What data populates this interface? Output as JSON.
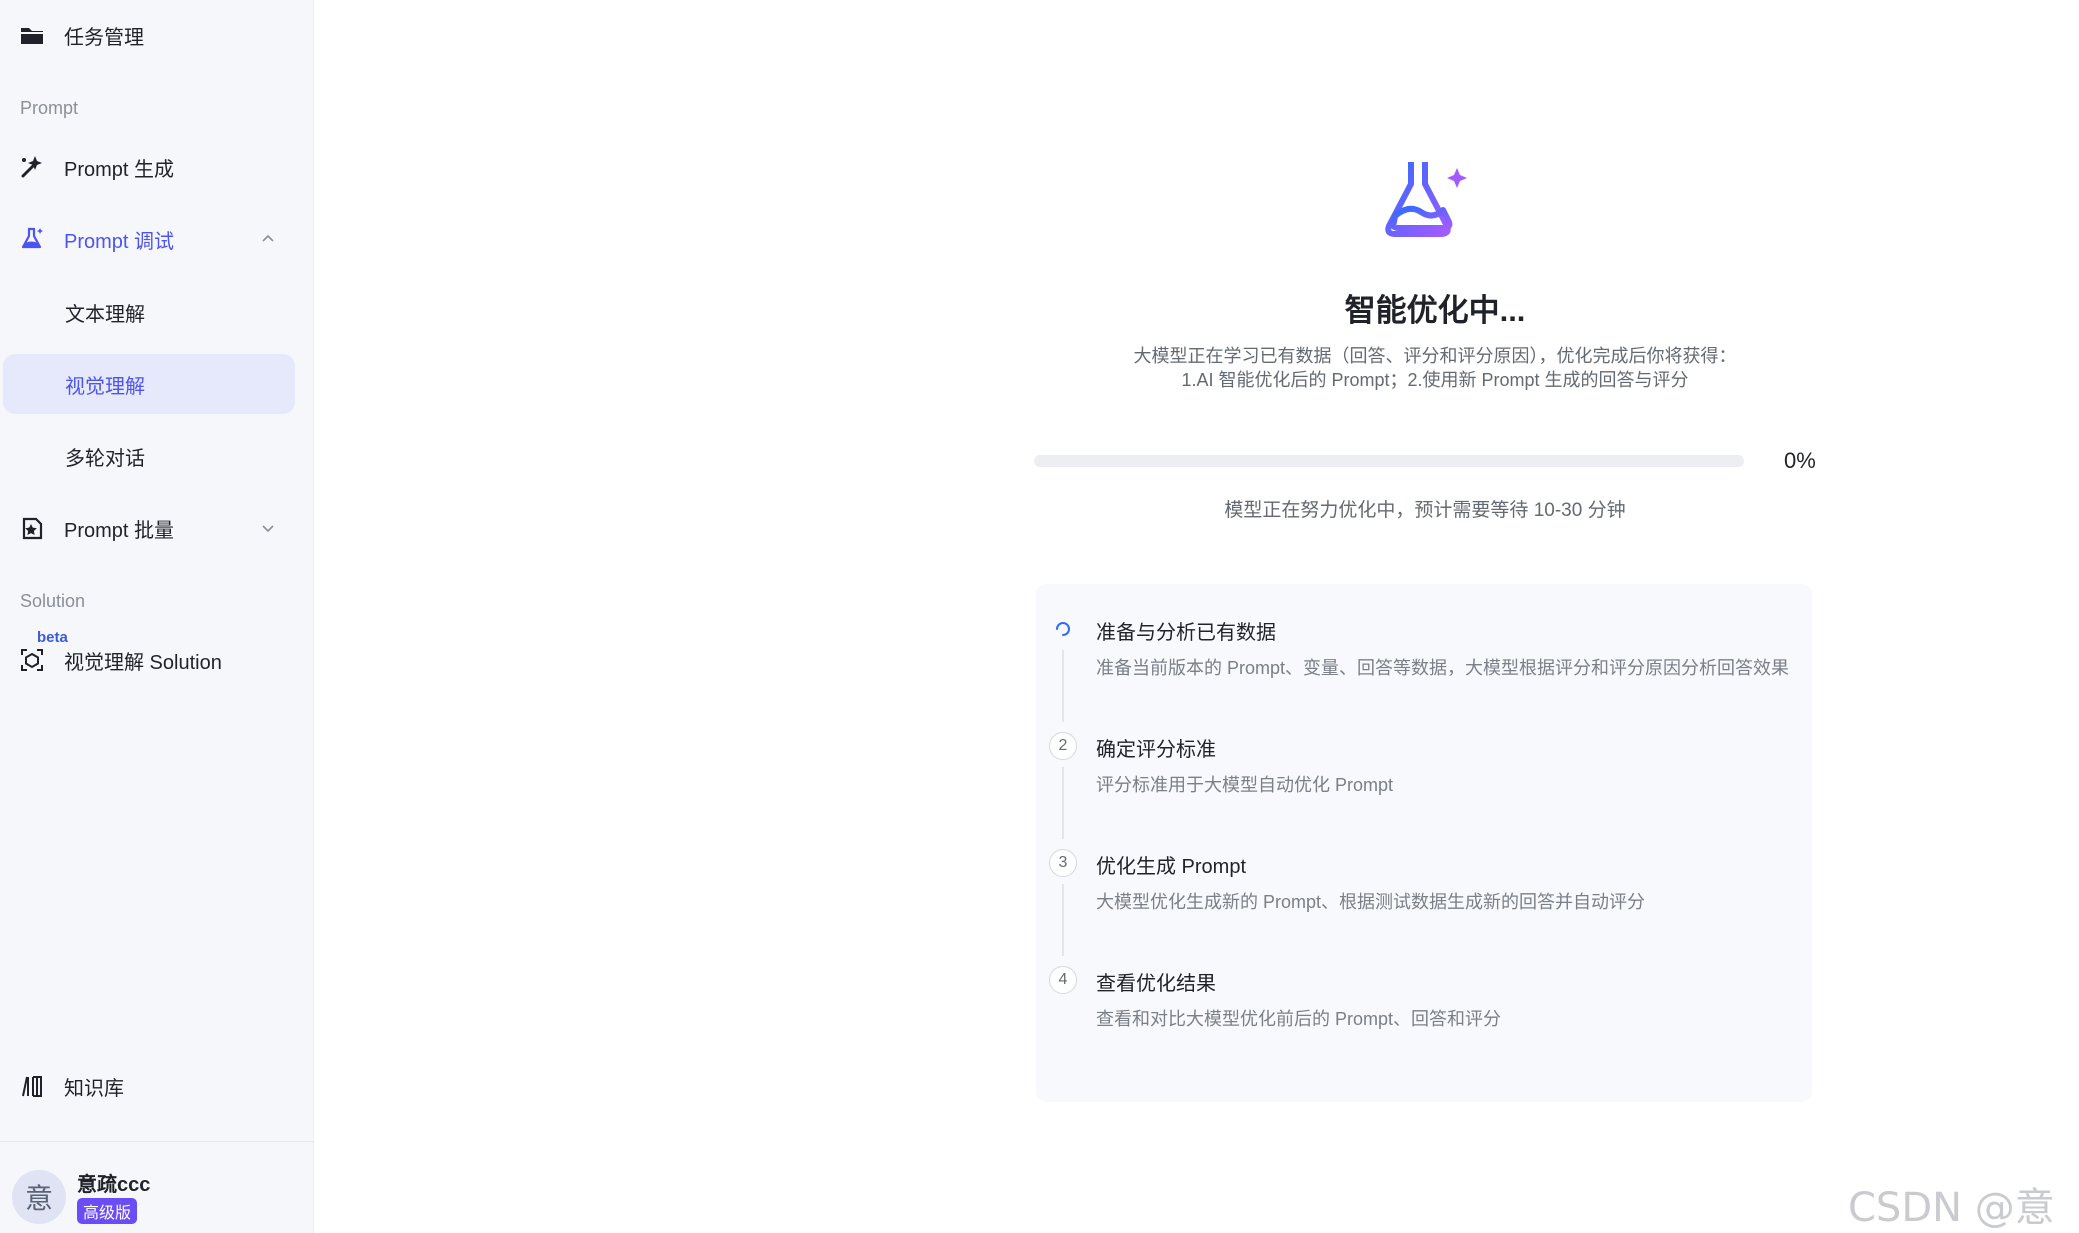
{
  "sidebar": {
    "top_item": {
      "label": "任务管理",
      "icon": "folder-icon"
    },
    "section_prompt": "Prompt",
    "prompt_generate": {
      "label": "Prompt 生成",
      "icon": "magic-wand-icon"
    },
    "prompt_debug": {
      "label": "Prompt 调试",
      "icon": "flask-icon",
      "expanded": true
    },
    "sub_items": [
      {
        "label": "文本理解",
        "selected": false
      },
      {
        "label": "视觉理解",
        "selected": true
      },
      {
        "label": "多轮对话",
        "selected": false
      }
    ],
    "prompt_batch": {
      "label": "Prompt 批量",
      "icon": "batch-icon",
      "expanded": false
    },
    "section_solution": "Solution",
    "visual_solution": {
      "label": "视觉理解 Solution",
      "badge": "beta",
      "icon": "cube-scan-icon"
    },
    "knowledge_base": {
      "label": "知识库",
      "icon": "books-icon"
    },
    "user": {
      "avatar_char": "意",
      "name": "意疏ccc",
      "plan_badge": "高级版"
    }
  },
  "main": {
    "title": "智能优化中...",
    "desc_line1": "大模型正在学习已有数据（回答、评分和评分原因），优化完成后你将获得：",
    "desc_line2": "1.AI 智能优化后的 Prompt；2.使用新 Prompt 生成的回答与评分",
    "progress": {
      "value": 0,
      "label": "0%"
    },
    "wait_text": "模型正在努力优化中，预计需要等待 10-30 分钟",
    "steps": [
      {
        "marker": "",
        "status": "loading",
        "title": "准备与分析已有数据",
        "desc": "准备当前版本的 Prompt、变量、回答等数据，大模型根据评分和评分原因分析回答效果"
      },
      {
        "marker": "2",
        "status": "pending",
        "title": "确定评分标准",
        "desc": "评分标准用于大模型自动优化 Prompt"
      },
      {
        "marker": "3",
        "status": "pending",
        "title": "优化生成 Prompt",
        "desc": "大模型优化生成新的 Prompt、根据测试数据生成新的回答并自动评分"
      },
      {
        "marker": "4",
        "status": "pending",
        "title": "查看优化结果",
        "desc": "查看和对比大模型优化前后的 Prompt、回答和评分"
      }
    ]
  },
  "watermark": "CSDN @意疏",
  "colors": {
    "accent": "#4e54f0",
    "sidebar_bg": "#f6f7fb",
    "selected_bg": "#e6e8fb",
    "badge_purple": "#6a4df5"
  }
}
